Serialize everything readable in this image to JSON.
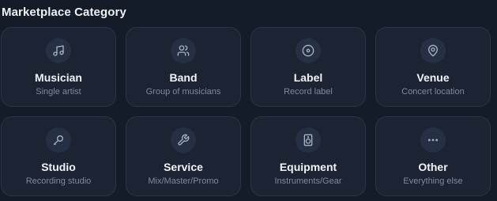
{
  "section": {
    "title": "Marketplace Category"
  },
  "categories": [
    {
      "title": "Musician",
      "subtitle": "Single artist",
      "icon": "music-note-icon"
    },
    {
      "title": "Band",
      "subtitle": "Group of musicians",
      "icon": "users-icon"
    },
    {
      "title": "Label",
      "subtitle": "Record label",
      "icon": "disc-icon"
    },
    {
      "title": "Venue",
      "subtitle": "Concert location",
      "icon": "map-pin-icon"
    },
    {
      "title": "Studio",
      "subtitle": "Recording studio",
      "icon": "microphone-icon"
    },
    {
      "title": "Service",
      "subtitle": "Mix/Master/Promo",
      "icon": "wrench-icon"
    },
    {
      "title": "Equipment",
      "subtitle": "Instruments/Gear",
      "icon": "speaker-icon"
    },
    {
      "title": "Other",
      "subtitle": "Everything else",
      "icon": "more-horizontal-icon"
    }
  ]
}
